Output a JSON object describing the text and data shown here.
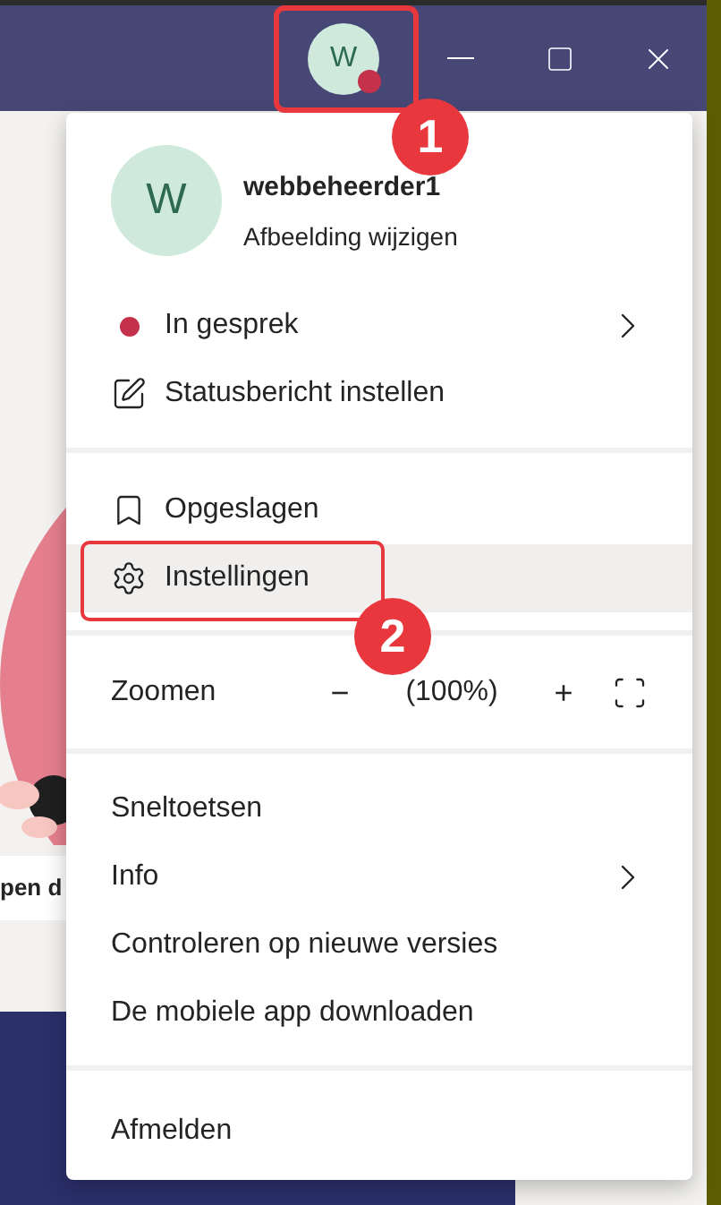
{
  "title_bar": {
    "avatar": {
      "initial": "W",
      "color": "#c4314b"
    }
  },
  "background": {
    "card_text": "pen d"
  },
  "menu": {
    "profile": {
      "initial": "W",
      "name": "webbeheerder1",
      "link": "Afbeelding wijzigen"
    },
    "sections": [
      {
        "items": [
          {
            "kind": "status",
            "label": "In gesprek",
            "color": "#c4314b",
            "submenu": true,
            "highlighted": false
          },
          {
            "kind": "message",
            "label": "Statusbericht instellen",
            "submenu": false,
            "highlighted": false
          }
        ]
      },
      {
        "items": [
          {
            "kind": "saved",
            "label": "Opgeslagen",
            "submenu": false,
            "highlighted": false
          },
          {
            "kind": "settings",
            "label": "Instellingen",
            "submenu": false,
            "highlighted": true
          }
        ]
      },
      {
        "items": [
          {
            "kind": "zoom",
            "label": "Zoomen",
            "decrease": "−",
            "value": "(100%)",
            "increase": "+"
          }
        ]
      },
      {
        "items": [
          {
            "kind": "plain",
            "label": "Sneltoetsen",
            "submenu": false,
            "highlighted": false
          },
          {
            "kind": "plain",
            "label": "Info",
            "submenu": true,
            "highlighted": false
          },
          {
            "kind": "plain",
            "label": "Controleren op nieuwe versies",
            "submenu": false,
            "highlighted": false
          },
          {
            "kind": "plain",
            "label": "De mobiele app downloaden",
            "submenu": false,
            "highlighted": false
          }
        ]
      },
      {
        "items": [
          {
            "kind": "plain",
            "label": "Afmelden",
            "submenu": false,
            "highlighted": false
          }
        ]
      }
    ]
  },
  "annotations": [
    {
      "label": "1"
    },
    {
      "label": "2"
    }
  ]
}
